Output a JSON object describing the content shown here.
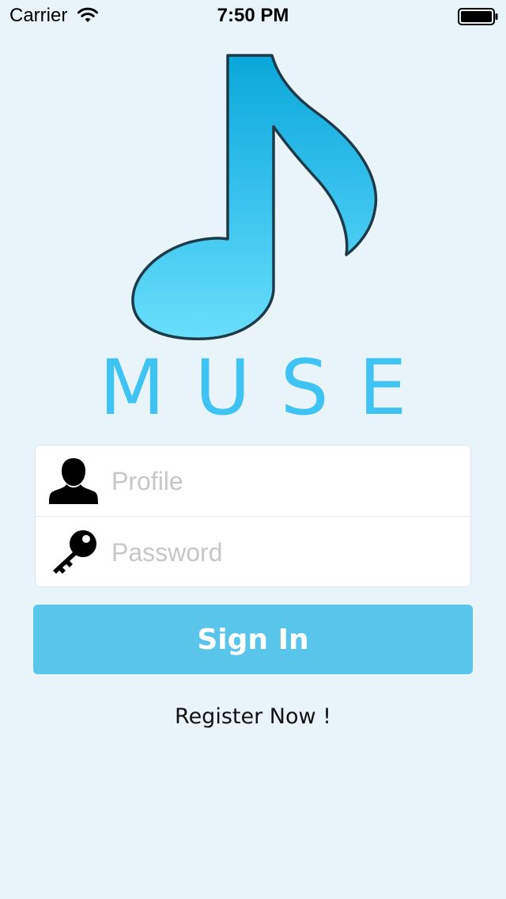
{
  "status_bar": {
    "carrier": "Carrier",
    "time": "7:50 PM",
    "wifi_icon": "wifi-icon",
    "battery_icon": "battery-icon"
  },
  "logo": {
    "icon": "music-note-icon",
    "app_name": "MUSE",
    "color": "#3EC3F2"
  },
  "form": {
    "profile": {
      "icon": "user-icon",
      "value": "",
      "placeholder": "Profile"
    },
    "password": {
      "icon": "key-icon",
      "value": "",
      "placeholder": "Password"
    }
  },
  "actions": {
    "sign_in_label": "Sign In",
    "sign_in_color": "#5AC5EA",
    "register_label": "Register Now !"
  },
  "colors": {
    "background": "#E9F4FA",
    "card": "#FFFFFF"
  }
}
